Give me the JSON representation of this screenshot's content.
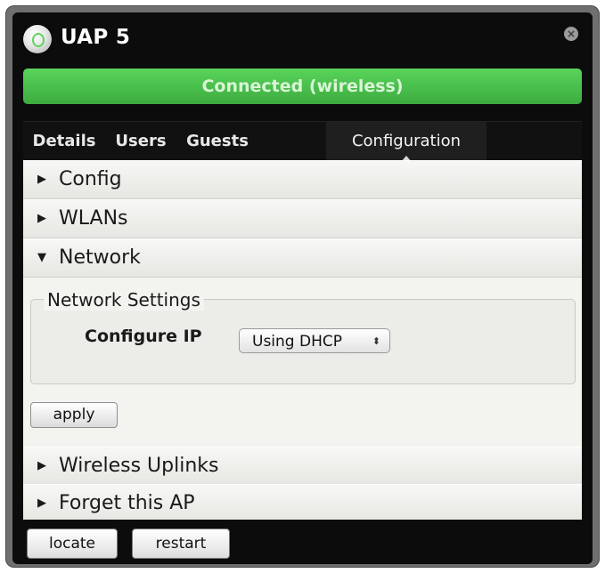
{
  "window": {
    "title": "UAP 5",
    "status": "Connected (wireless)",
    "status_color": "#4cc24e",
    "close_icon": "close-icon",
    "device_icon": "ap-device-icon"
  },
  "tabs": [
    {
      "label": "Details",
      "active": false
    },
    {
      "label": "Users",
      "active": false
    },
    {
      "label": "Guests",
      "active": false
    },
    {
      "label": "Configuration",
      "active": true
    }
  ],
  "sections": [
    {
      "label": "Config",
      "expanded": false
    },
    {
      "label": "WLANs",
      "expanded": false
    },
    {
      "label": "Network",
      "expanded": true
    },
    {
      "label": "Wireless Uplinks",
      "expanded": false
    },
    {
      "label": "Forget this AP",
      "expanded": false
    }
  ],
  "network": {
    "legend": "Network Settings",
    "configure_ip_label": "Configure IP",
    "configure_ip_value": "Using DHCP",
    "apply_label": "apply"
  },
  "footer": {
    "locate_label": "locate",
    "restart_label": "restart"
  }
}
